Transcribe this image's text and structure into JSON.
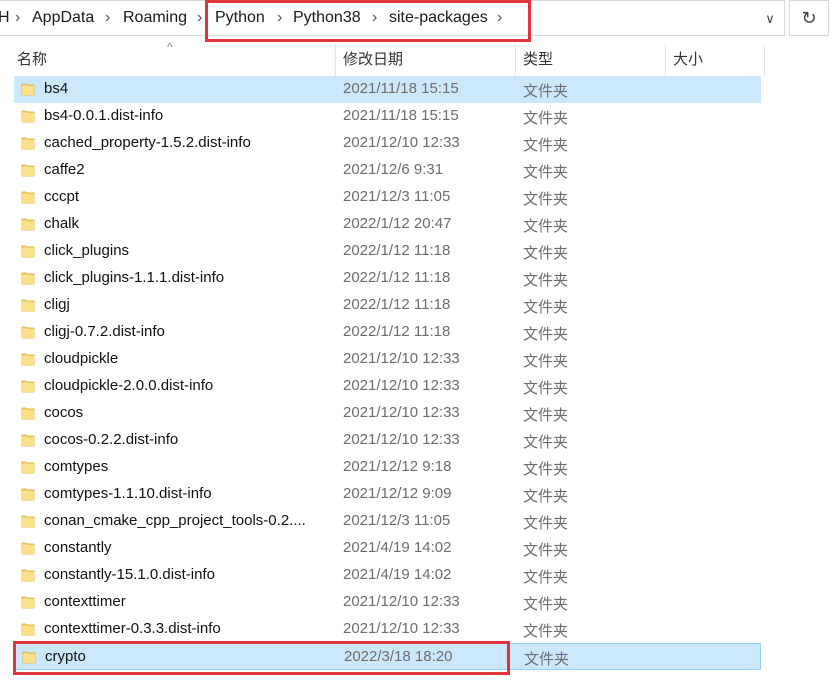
{
  "address": {
    "crumbs": [
      "AppData",
      "Roaming",
      "Python",
      "Python38",
      "site-packages"
    ],
    "cut_glyph": "H",
    "dropdown_glyph": "∨",
    "refresh_glyph": "↻",
    "separator": "›"
  },
  "columns": {
    "name": "名称",
    "date": "修改日期",
    "type": "类型",
    "size": "大小",
    "sort_indicator": "^"
  },
  "files": [
    {
      "name": "bs4",
      "date": "2021/11/18 15:15",
      "type": "文件夹"
    },
    {
      "name": "bs4-0.0.1.dist-info",
      "date": "2021/11/18 15:15",
      "type": "文件夹"
    },
    {
      "name": "cached_property-1.5.2.dist-info",
      "date": "2021/12/10 12:33",
      "type": "文件夹"
    },
    {
      "name": "caffe2",
      "date": "2021/12/6 9:31",
      "type": "文件夹"
    },
    {
      "name": "cccpt",
      "date": "2021/12/3 11:05",
      "type": "文件夹"
    },
    {
      "name": "chalk",
      "date": "2022/1/12 20:47",
      "type": "文件夹"
    },
    {
      "name": "click_plugins",
      "date": "2022/1/12 11:18",
      "type": "文件夹"
    },
    {
      "name": "click_plugins-1.1.1.dist-info",
      "date": "2022/1/12 11:18",
      "type": "文件夹"
    },
    {
      "name": "cligj",
      "date": "2022/1/12 11:18",
      "type": "文件夹"
    },
    {
      "name": "cligj-0.7.2.dist-info",
      "date": "2022/1/12 11:18",
      "type": "文件夹"
    },
    {
      "name": "cloudpickle",
      "date": "2021/12/10 12:33",
      "type": "文件夹"
    },
    {
      "name": "cloudpickle-2.0.0.dist-info",
      "date": "2021/12/10 12:33",
      "type": "文件夹"
    },
    {
      "name": "cocos",
      "date": "2021/12/10 12:33",
      "type": "文件夹"
    },
    {
      "name": "cocos-0.2.2.dist-info",
      "date": "2021/12/10 12:33",
      "type": "文件夹"
    },
    {
      "name": "comtypes",
      "date": "2021/12/12 9:18",
      "type": "文件夹"
    },
    {
      "name": "comtypes-1.1.10.dist-info",
      "date": "2021/12/12 9:09",
      "type": "文件夹"
    },
    {
      "name": "conan_cmake_cpp_project_tools-0.2....",
      "date": "2021/12/3 11:05",
      "type": "文件夹"
    },
    {
      "name": "constantly",
      "date": "2021/4/19 14:02",
      "type": "文件夹"
    },
    {
      "name": "constantly-15.1.0.dist-info",
      "date": "2021/4/19 14:02",
      "type": "文件夹"
    },
    {
      "name": "contexttimer",
      "date": "2021/12/10 12:33",
      "type": "文件夹"
    },
    {
      "name": "contexttimer-0.3.3.dist-info",
      "date": "2021/12/10 12:33",
      "type": "文件夹"
    },
    {
      "name": "crypto",
      "date": "2022/3/18 18:20",
      "type": "文件夹"
    }
  ],
  "colors": {
    "selection": "#cce8ff",
    "highlight_box": "#e0353b",
    "folder": "#f8d775"
  }
}
